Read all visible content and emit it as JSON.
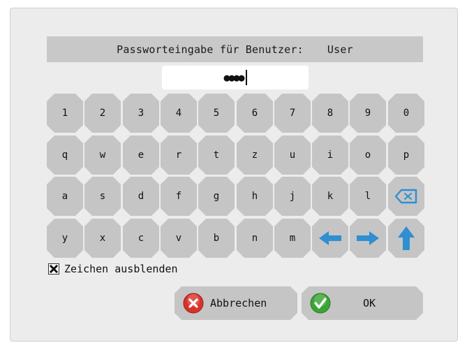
{
  "dialog": {
    "title_prefix": "Passworteingabe für Benutzer:",
    "user": "User",
    "password_mask": "●●●●"
  },
  "keyboard": {
    "row1": [
      "1",
      "2",
      "3",
      "4",
      "5",
      "6",
      "7",
      "8",
      "9",
      "0"
    ],
    "row2": [
      "q",
      "w",
      "e",
      "r",
      "t",
      "z",
      "u",
      "i",
      "o",
      "p"
    ],
    "row3": [
      "a",
      "s",
      "d",
      "f",
      "g",
      "h",
      "j",
      "k",
      "l"
    ],
    "row4": [
      "y",
      "x",
      "c",
      "v",
      "b",
      "n",
      "m"
    ],
    "special_icons": [
      "backspace-icon",
      "arrow-left-icon",
      "arrow-right-icon",
      "shift-arrow-up-icon"
    ]
  },
  "options": {
    "hide_chars_label": "Zeichen ausblenden",
    "hide_chars_checked": true
  },
  "buttons": {
    "cancel_label": "Abbrechen",
    "ok_label": "OK"
  },
  "colors": {
    "key_bg": "#c5c5c5",
    "dialog_bg": "#ececec",
    "arrow_blue": "#2f8fd0",
    "cancel_red": "#d8322b",
    "ok_green": "#3aa335"
  }
}
